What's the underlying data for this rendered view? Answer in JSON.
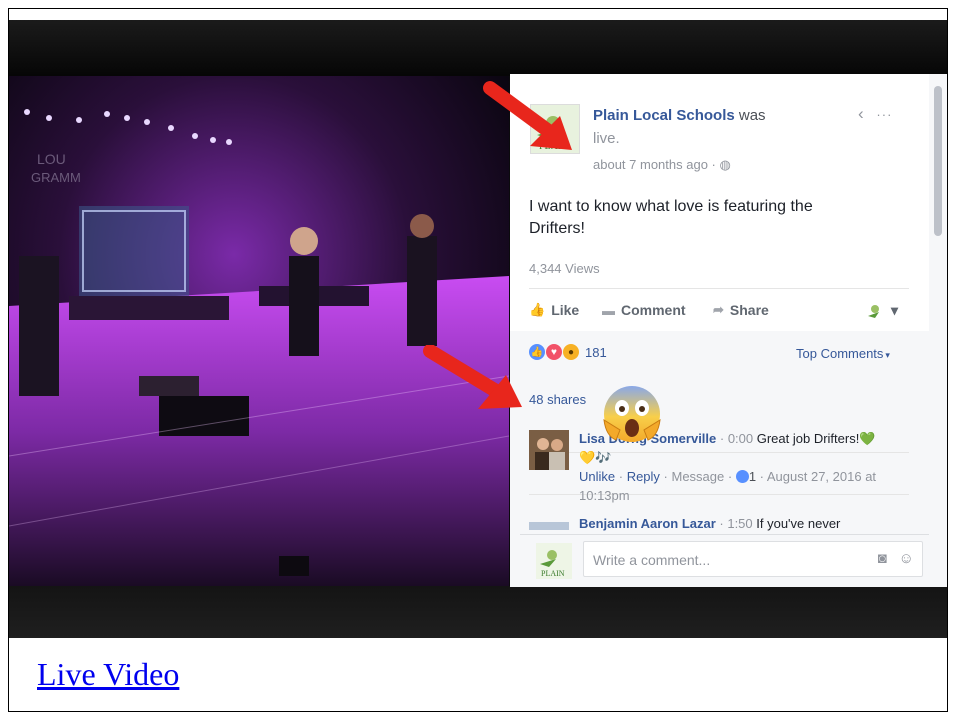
{
  "post": {
    "page_name": "Plain Local Schools",
    "status_a": " was",
    "status_b": "live.",
    "time": "about 7 months ago · ",
    "globe_glyph": "◍",
    "nav_back_glyph": "‹",
    "more_glyph": "···",
    "text": "I want to know what love is featuring the Drifters!",
    "views": "4,344 Views",
    "avatar_logo_text": "PLAIN"
  },
  "actions": {
    "like": "Like",
    "comment": "Comment",
    "share": "Share",
    "dropdown_glyph": "▾"
  },
  "reactions": {
    "count": "181",
    "top_comments": "Top Comments",
    "top_comments_caret": "▾",
    "shares": "48 shares",
    "icons": [
      "like-icon",
      "love-icon",
      "wow-icon"
    ]
  },
  "comments": [
    {
      "author": "Lisa Dorng Somerville",
      "meta": " · 0:00 ",
      "text": "Great job Drifters!",
      "emojis": "💚💛🎶",
      "unlike": "Unlike",
      "reply": "Reply",
      "message": "Message",
      "likes": "1",
      "date": "August 27, 2016 at 10:13pm"
    },
    {
      "author": "Benjamin Aaron Lazar",
      "meta": " · 1:50 ",
      "text": "If you've never"
    }
  ],
  "composer": {
    "placeholder": "Write a comment...",
    "camera_icon": "camera-icon",
    "emoji_icon": "smiley-icon"
  },
  "footer": {
    "link": "Live Video"
  },
  "colors": {
    "facebook_link": "#365899",
    "arrow_red": "#e8261c",
    "stage_purple": "#b23cf0",
    "hyperlink": "#0000ee"
  }
}
